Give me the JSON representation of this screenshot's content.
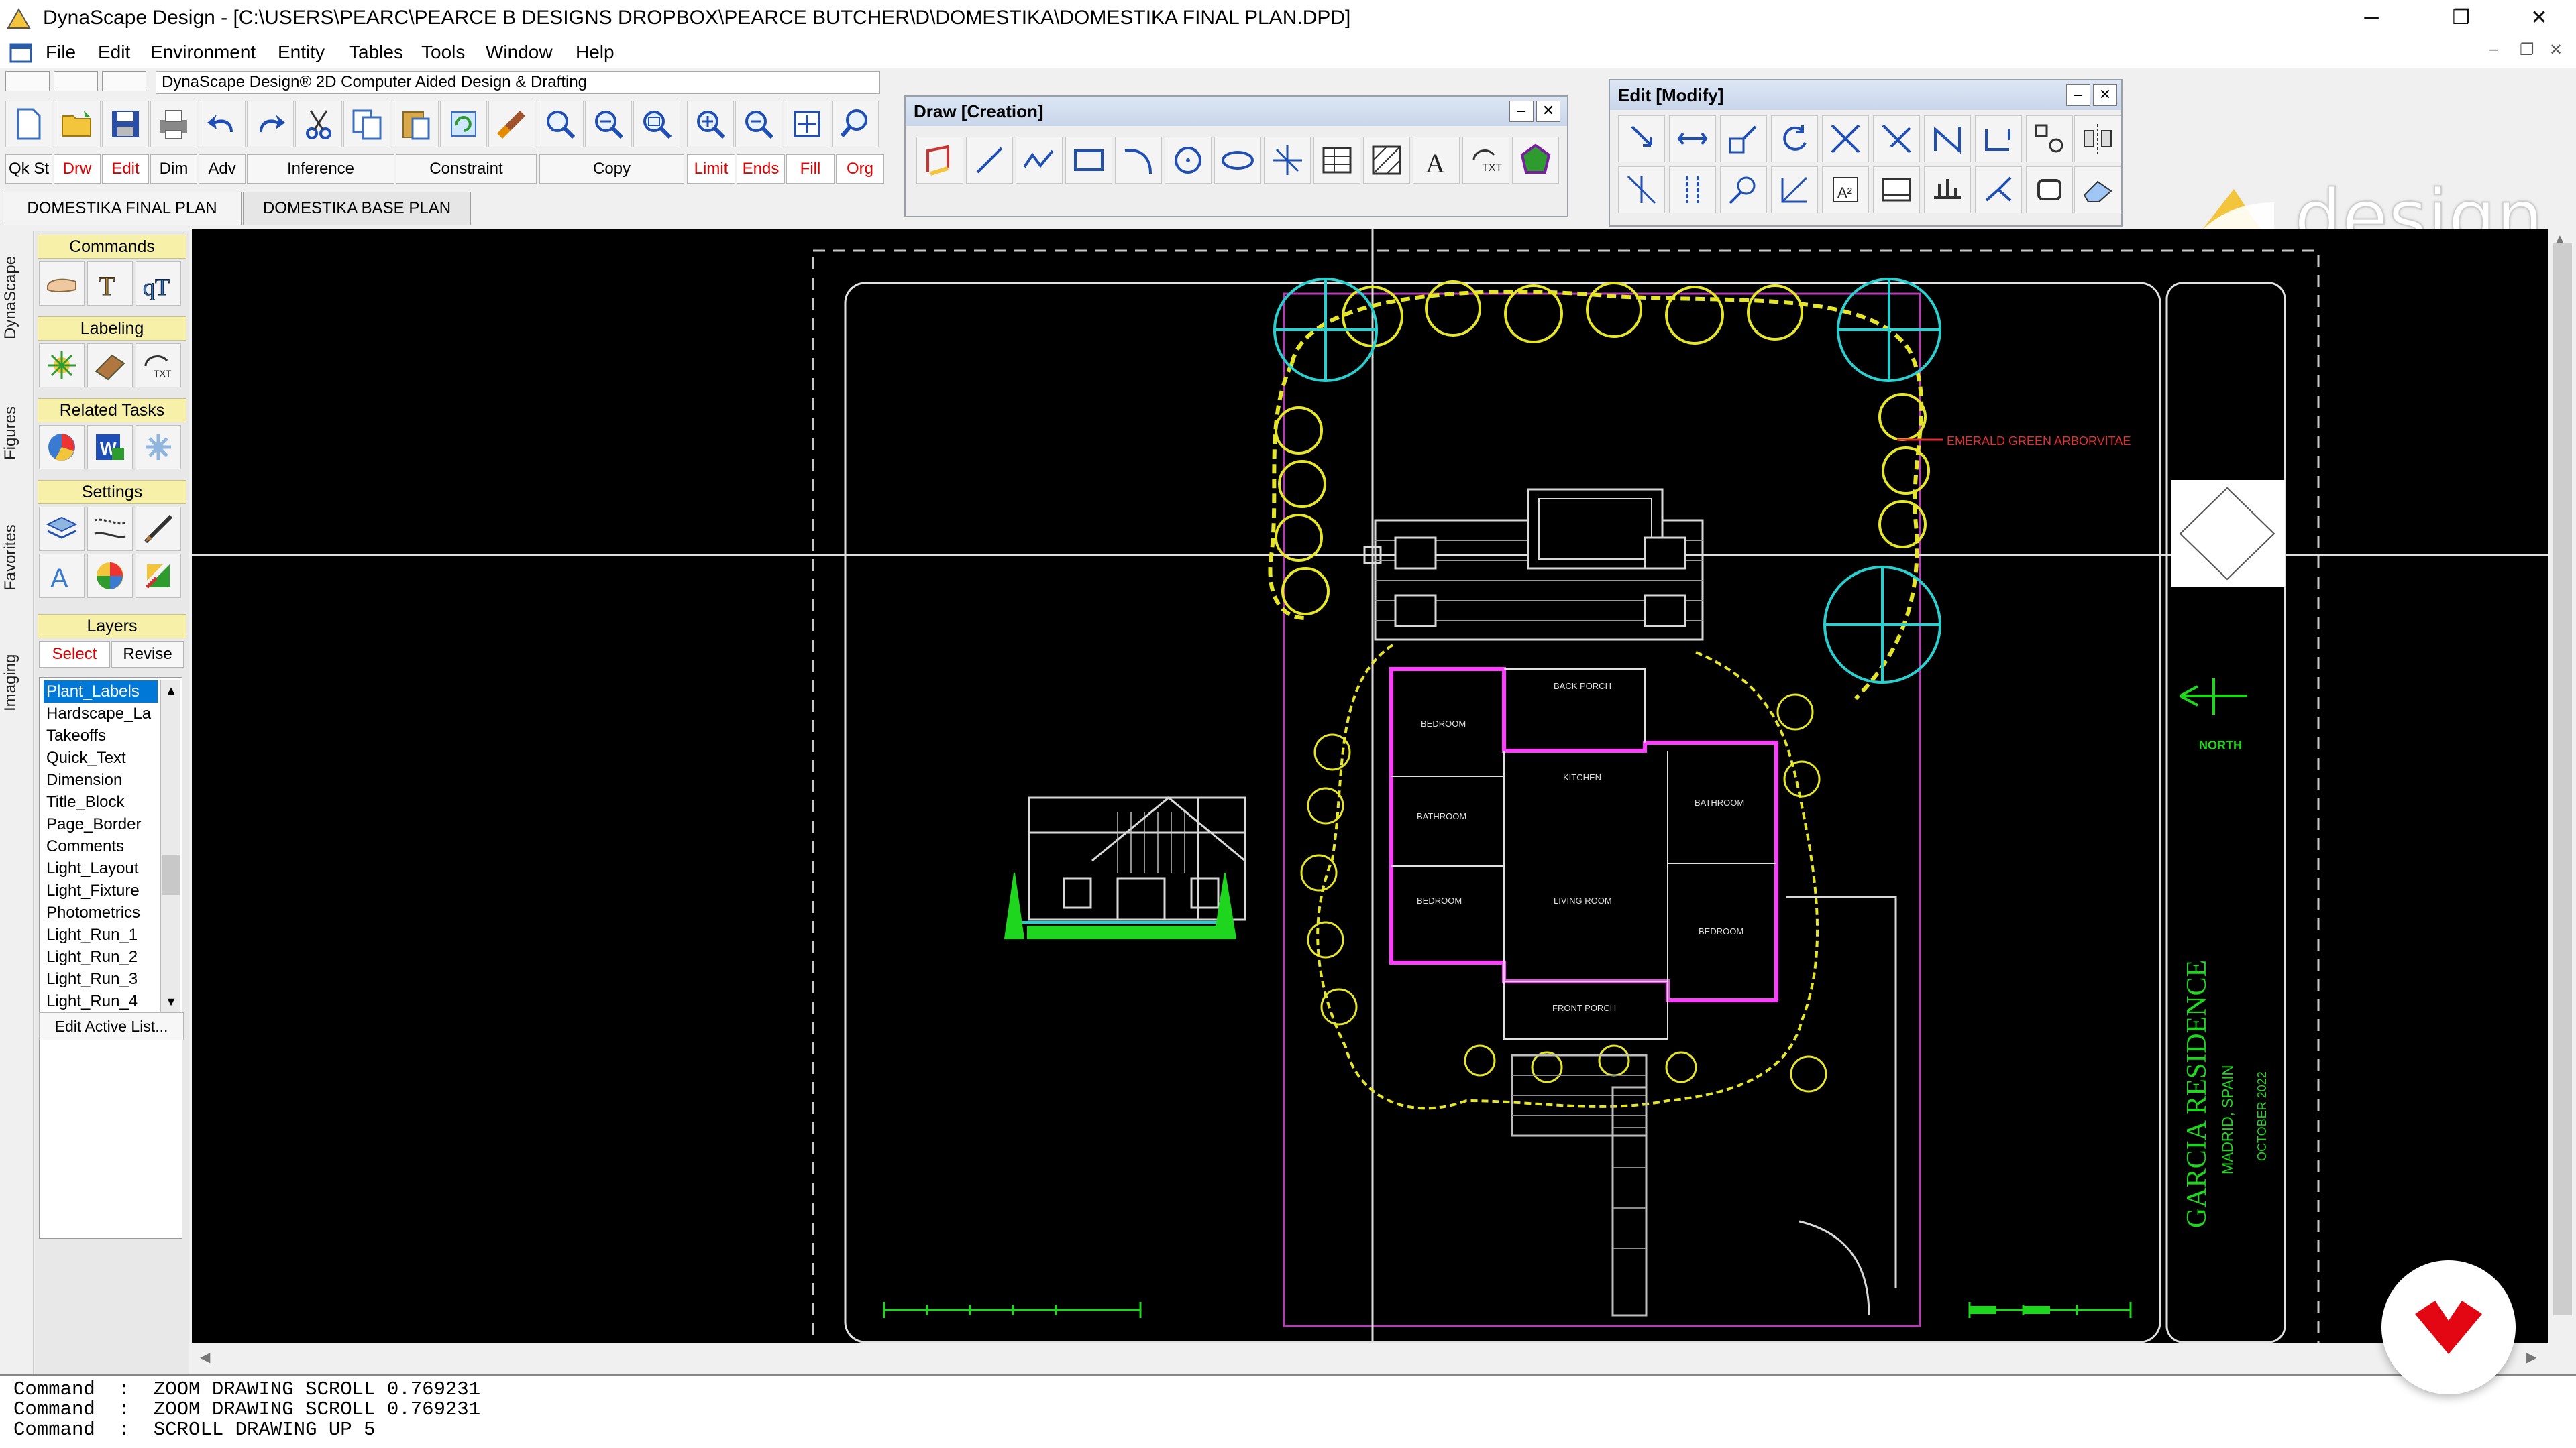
{
  "window": {
    "title": "DynaScape Design   - [C:\\USERS\\PEARC\\PEARCE B DESIGNS DROPBOX\\PEARCE BUTCHER\\D\\DOMESTIKA\\DOMESTIKA FINAL PLAN.DPD]"
  },
  "menu": [
    "File",
    "Edit",
    "Environment",
    "Entity",
    "Tables",
    "Tools",
    "Window",
    "Help"
  ],
  "toolbar": {
    "caption": "DynaScape Design® 2D Computer Aided Design & Drafting",
    "modes": [
      "Qk St",
      "Drw",
      "Edit",
      "Dim",
      "Adv",
      "Inference",
      "Constraint",
      "Copy",
      "Limit",
      "Ends",
      "Fill",
      "Org"
    ]
  },
  "draw_panel": {
    "title": "Draw [Creation]"
  },
  "edit_panel": {
    "title": "Edit [Modify]"
  },
  "brand": {
    "logo_text": "design",
    "accent": "#f2c53d",
    "badge_color": "#e30613"
  },
  "tabs": [
    "DOMESTIKA FINAL PLAN",
    "DOMESTIKA BASE PLAN"
  ],
  "left_tabs": [
    "DynaScape",
    "Figures",
    "Favorites",
    "Imaging"
  ],
  "sidebar": {
    "sections": {
      "commands": "Commands",
      "labeling": "Labeling",
      "related": "Related Tasks",
      "settings": "Settings",
      "layers": "Layers"
    },
    "layer_modes": [
      "Select",
      "Revise"
    ],
    "layers": [
      "Plant_Labels",
      "Hardscape_La",
      "Takeoffs",
      "Quick_Text",
      "Dimension",
      "Title_Block",
      "Page_Border",
      "Comments",
      "Light_Layout",
      "Light_Fixture",
      "Photometrics",
      "Light_Run_1",
      "Light_Run_2",
      "Light_Run_3",
      "Light_Run_4"
    ],
    "edit_list": "Edit Active List..."
  },
  "drawing": {
    "rooms": [
      "BACK PORCH",
      "BEDROOM",
      "KITCHEN",
      "BATHROOM",
      "BATHROOM",
      "BEDROOM",
      "LIVING ROOM",
      "BEDROOM",
      "FRONT PORCH"
    ],
    "callout": "EMERALD GREEN ARBORVITAE",
    "north": "NORTH",
    "title_block": {
      "project": "GARCIA RESIDENCE",
      "location": "MADRID, SPAIN",
      "date": "OCTOBER 2022"
    }
  },
  "command_history": [
    "Command  :  ZOOM DRAWING SCROLL 0.769231",
    "Command  :  ZOOM DRAWING SCROLL 0.769231",
    "Command  :  SCROLL DRAWING UP 5"
  ]
}
